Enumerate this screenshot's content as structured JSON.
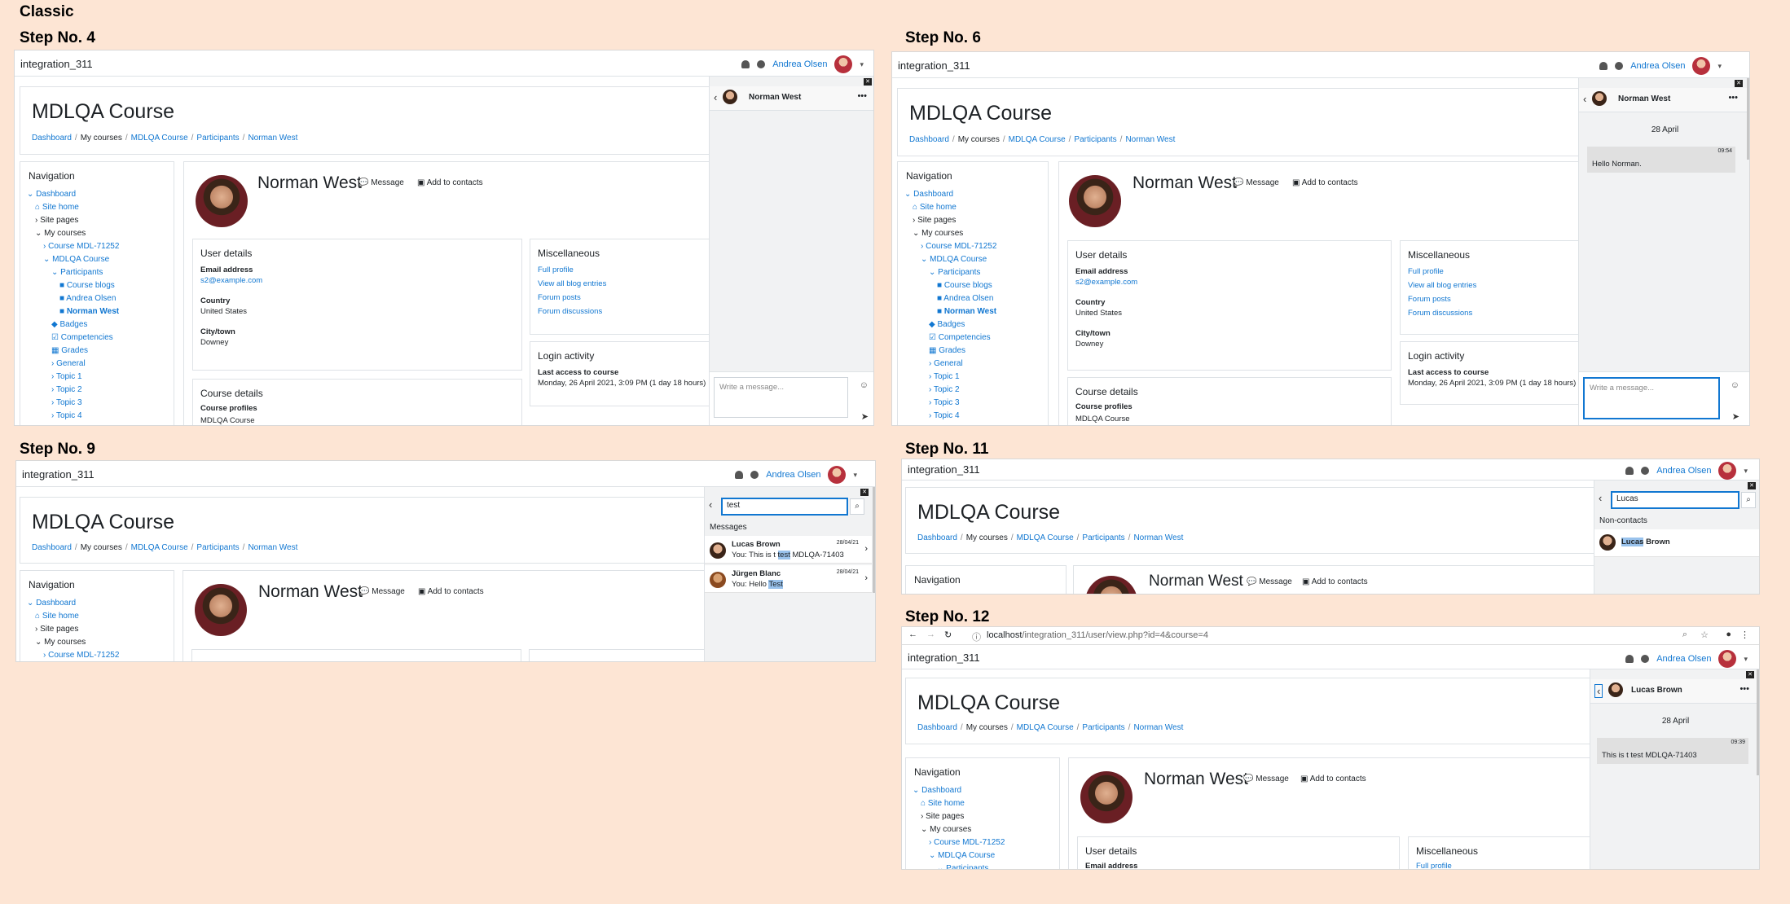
{
  "page_title": "Classic",
  "site_name": "integration_311",
  "user_name": "Andrea Olsen",
  "course_title": "MDLQA Course",
  "breadcrumb": [
    "Dashboard",
    "My courses",
    "MDLQA Course",
    "Participants",
    "Norman West"
  ],
  "profile": {
    "name": "Norman West",
    "message_label": "Message",
    "add_contacts_label": "Add to contacts"
  },
  "navigation": {
    "title": "Navigation",
    "items": [
      "Dashboard",
      "Site home",
      "Site pages",
      "My courses",
      "Course MDL-71252",
      "MDLQA Course",
      "Participants",
      "Course blogs",
      "Andrea Olsen",
      "Norman West",
      "Badges",
      "Competencies",
      "Grades",
      "General",
      "Topic 1",
      "Topic 2",
      "Topic 3",
      "Topic 4"
    ]
  },
  "user_details": {
    "title": "User details",
    "email_label": "Email address",
    "email": "s2@example.com",
    "country_label": "Country",
    "country": "United States",
    "city_label": "City/town",
    "city": "Downey"
  },
  "misc": {
    "title": "Miscellaneous",
    "links": [
      "Full profile",
      "View all blog entries",
      "Forum posts",
      "Forum discussions"
    ]
  },
  "login": {
    "title": "Login activity",
    "last_access_label": "Last access to course",
    "last_access": "Monday, 26 April 2021, 3:09 PM  (1 day 18 hours)"
  },
  "course_details": {
    "title": "Course details",
    "profiles_label": "Course profiles",
    "profiles_value": "MDLQA Course"
  },
  "step4": {
    "title": "Step No. 4",
    "contact": "Norman West",
    "placeholder": "Write a message..."
  },
  "step6": {
    "title": "Step No. 6",
    "contact": "Norman West",
    "date": "28 April",
    "time": "09:54",
    "message": "Hello Norman.",
    "placeholder": "Write a message..."
  },
  "step9": {
    "title": "Step No. 9",
    "search": "test",
    "section": "Messages",
    "results": [
      {
        "name": "Lucas Brown",
        "pre": "You: This is t ",
        "hl": "test",
        "post": " MDLQA-71403",
        "date": "28/04/21"
      },
      {
        "name": "Jürgen Blanc",
        "pre": "You: Hello ",
        "hl": "Test",
        "post": "",
        "date": "28/04/21"
      }
    ]
  },
  "step11": {
    "title": "Step No. 11",
    "search": "Lucas",
    "section": "Non-contacts",
    "result_hl": "Lucas",
    "result_rest": " Brown"
  },
  "step12": {
    "title": "Step No. 12",
    "url_host": "localhost",
    "url_path": "/integration_311/user/view.php?id=4&course=4",
    "contact": "Lucas Brown",
    "date": "28 April",
    "time": "09:39",
    "message": "This is t test MDLQA-71403"
  }
}
